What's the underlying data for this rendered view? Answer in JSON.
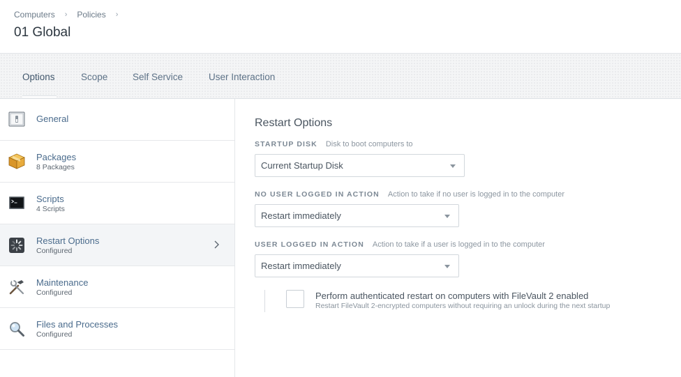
{
  "breadcrumb": [
    "Computers",
    "Policies"
  ],
  "page_title": "01 Global",
  "tabs": [
    {
      "label": "Options",
      "active": true
    },
    {
      "label": "Scope"
    },
    {
      "label": "Self Service"
    },
    {
      "label": "User Interaction"
    }
  ],
  "sidebar": {
    "items": [
      {
        "label": "General",
        "sub": "",
        "icon": "switch-icon"
      },
      {
        "label": "Packages",
        "sub": "8 Packages",
        "icon": "package-box-icon"
      },
      {
        "label": "Scripts",
        "sub": "4 Scripts",
        "icon": "terminal-icon"
      },
      {
        "label": "Restart Options",
        "sub": "Configured",
        "icon": "restart-spinner-icon",
        "active": true
      },
      {
        "label": "Maintenance",
        "sub": "Configured",
        "icon": "tools-icon"
      },
      {
        "label": "Files and Processes",
        "sub": "Configured",
        "icon": "magnifier-icon"
      }
    ]
  },
  "main": {
    "section_title": "Restart Options",
    "startup_disk": {
      "label": "STARTUP DISK",
      "hint": "Disk to boot computers to",
      "value": "Current Startup Disk"
    },
    "no_user_action": {
      "label": "NO USER LOGGED IN ACTION",
      "hint": "Action to take if no user is logged in to the computer",
      "value": "Restart immediately"
    },
    "user_action": {
      "label": "USER LOGGED IN ACTION",
      "hint": "Action to take if a user is logged in to the computer",
      "value": "Restart immediately"
    },
    "filevault": {
      "label": "Perform authenticated restart on computers with FileVault 2 enabled",
      "sub": "Restart FileVault 2-encrypted computers without requiring an unlock during the next startup",
      "checked": false
    }
  },
  "colors": {
    "link": "#4a6b8c",
    "active_bg": "#f3f5f7",
    "border": "#e3e6e9"
  }
}
